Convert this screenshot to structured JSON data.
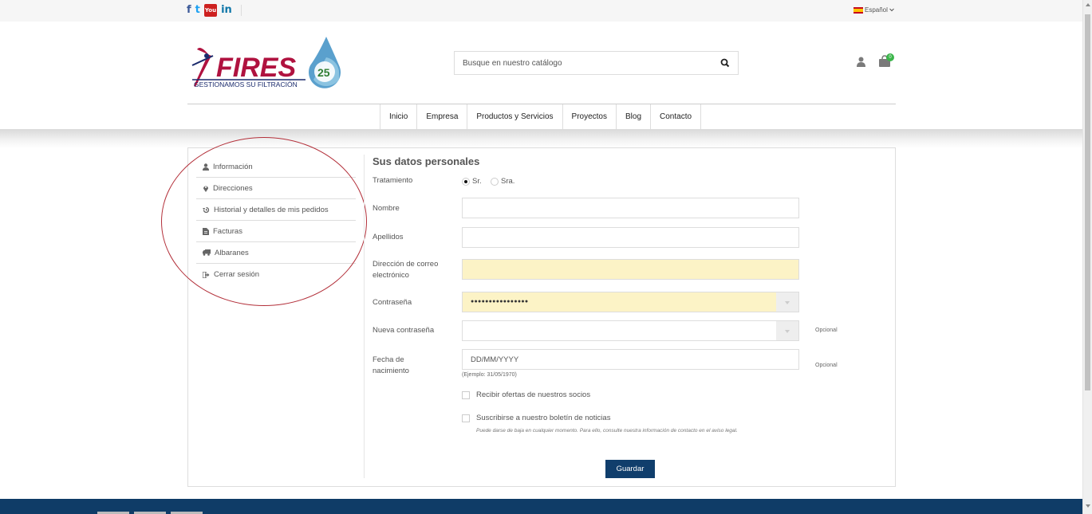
{
  "topbar": {
    "social": [
      {
        "icon": "facebook-icon",
        "glyph": "f"
      },
      {
        "icon": "twitter-icon",
        "glyph": "t"
      },
      {
        "icon": "youtube-icon",
        "glyph": "You"
      },
      {
        "icon": "linkedin-icon",
        "glyph": "in"
      }
    ],
    "language": "Español"
  },
  "header": {
    "logo_text": "FIRES",
    "logo_tagline": "GESTIONAMOS SU FILTRACIÓN",
    "logo_badge": "25",
    "search_placeholder": "Busque en nuestro catálogo",
    "cart_count": "0"
  },
  "nav": {
    "items": [
      "Inicio",
      "Empresa",
      "Productos y Servicios",
      "Proyectos",
      "Blog",
      "Contacto"
    ]
  },
  "sidebar": {
    "items": [
      {
        "label": "Información",
        "icon": "user-icon"
      },
      {
        "label": "Direcciones",
        "icon": "map-marker-icon"
      },
      {
        "label": "Historial y detalles de mis pedidos",
        "icon": "history-icon"
      },
      {
        "label": "Facturas",
        "icon": "file-icon"
      },
      {
        "label": "Albaranes",
        "icon": "truck-icon"
      },
      {
        "label": "Cerrar sesión",
        "icon": "sign-out-icon"
      }
    ]
  },
  "form": {
    "title": "Sus datos personales",
    "treatment_label": "Tratamiento",
    "treatment_options": [
      "Sr.",
      "Sra."
    ],
    "treatment_selected": "Sr.",
    "name_label": "Nombre",
    "surname_label": "Apellidos",
    "email_label_1": "Dirección de correo",
    "email_label_2": "electrónico",
    "password_label": "Contraseña",
    "password_value": "●●●●●●●●●●●●●●●●",
    "new_password_label": "Nueva contraseña",
    "optional": "Opcional",
    "birth_label_1": "Fecha de",
    "birth_label_2": "nacimiento",
    "birth_placeholder": "DD/MM/YYYY",
    "birth_hint": "(Ejemplo: 31/05/1970)",
    "offers_label": "Recibir ofertas de nuestros socios",
    "newsletter_label": "Suscribirse a nuestro boletín de noticias",
    "newsletter_note": "Puede darse de baja en cualquier momento. Para ello, consulte nuestra información de contacto en el aviso legal.",
    "save_label": "Guardar"
  },
  "colors": {
    "brand_red": "#b0123f",
    "primary": "#103e6c",
    "autofill": "#fcf3c6",
    "annotation": "#b3303a"
  }
}
